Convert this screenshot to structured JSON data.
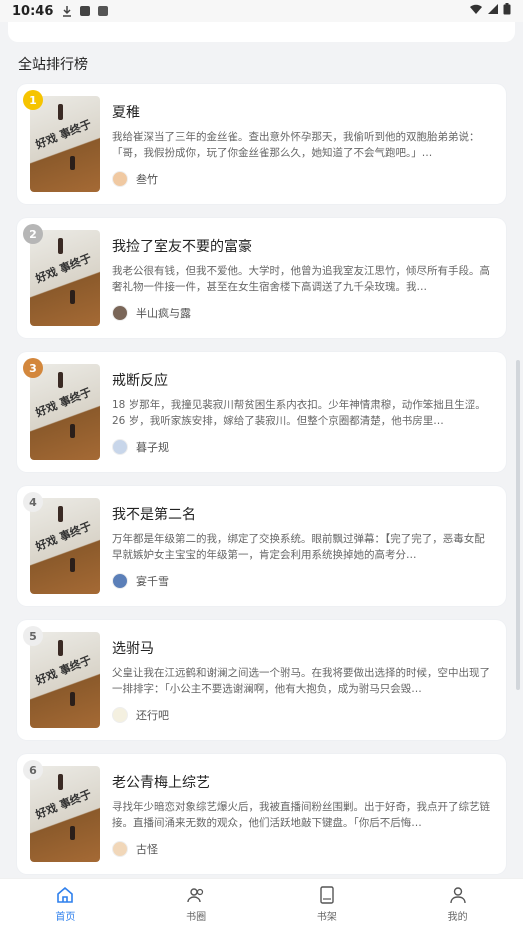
{
  "status_bar": {
    "time": "10:46"
  },
  "section": {
    "title": "全站排行榜"
  },
  "books": [
    {
      "rank": "1",
      "title": "夏稚",
      "desc": "我给崔深当了三年的金丝雀。查出意外怀孕那天，我偷听到他的双胞胎弟弟说：「哥，我假扮成你，玩了你金丝雀那么久，她知道了不会气跑吧。」…",
      "author": "叁竹"
    },
    {
      "rank": "2",
      "title": "我捡了室友不要的富豪",
      "desc": "我老公很有钱，但我不爱他。大学时，他曾为追我室友江思竹，倾尽所有手段。高奢礼物一件接一件，甚至在女生宿舍楼下高调送了九千朵玫瑰。我…",
      "author": "半山疯与露"
    },
    {
      "rank": "3",
      "title": "戒断反应",
      "desc": "18 岁那年，我撞见裴寂川帮贫困生系内衣扣。少年神情肃穆，动作笨拙且生涩。26 岁，我听家族安排，嫁给了裴寂川。但整个京圈都清楚，他书房里…",
      "author": "暮子规"
    },
    {
      "rank": "4",
      "title": "我不是第二名",
      "desc": "万年都是年级第二的我，绑定了交换系统。眼前飘过弹幕：【完了完了，恶毒女配早就嫉妒女主宝宝的年级第一，肯定会利用系统换掉她的高考分…",
      "author": "宴千雪"
    },
    {
      "rank": "5",
      "title": "选驸马",
      "desc": "父皇让我在江远鹤和谢澜之间选一个驸马。在我将要做出选择的时候，空中出现了一排排字：「小公主不要选谢澜啊，他有大抱负，成为驸马只会毁…",
      "author": "还行吧"
    },
    {
      "rank": "6",
      "title": "老公青梅上综艺",
      "desc": "寻找年少暗恋对象综艺爆火后，我被直播间粉丝围剿。出于好奇，我点开了综艺链接。直播间涌来无数的观众，他们活跃地敲下键盘。「你后不后悔…",
      "author": "古怪"
    }
  ],
  "cover_text": "好戏 事终于",
  "tabs": [
    {
      "label": "首页",
      "icon": "home-icon"
    },
    {
      "label": "书圈",
      "icon": "users-icon"
    },
    {
      "label": "书架",
      "icon": "book-icon"
    },
    {
      "label": "我的",
      "icon": "user-icon"
    }
  ],
  "colors": {
    "accent": "#2f80ed",
    "gold": "#f6c400",
    "silver": "#b6b6b6",
    "bronze": "#d3873c"
  }
}
